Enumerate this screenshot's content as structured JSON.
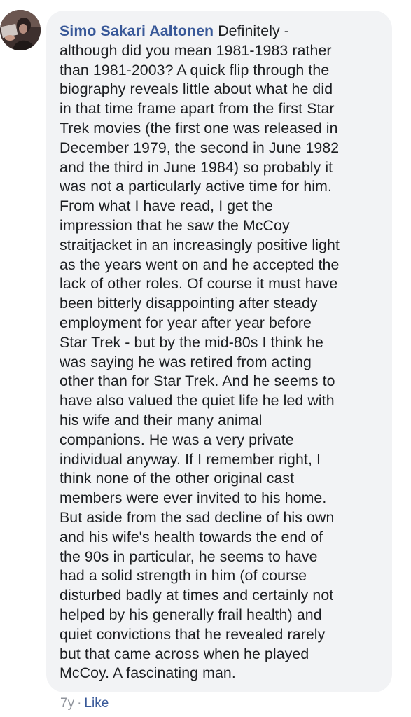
{
  "comment": {
    "author": "Simo Sakari Aaltonen",
    "lines": [
      "Definitely -",
      "although did you mean 1981-1983 rather",
      "than 1981-2003? A quick flip through the",
      "biography reveals little about what he did",
      "in that time frame apart from the first Star",
      "Trek movies (the first one was released in",
      "December 1979, the second in June 1982",
      "and the third in June 1984) so probably it",
      "was not a particularly active time for him.",
      "From what I have read, I get the",
      "impression that he saw the McCoy",
      "straitjacket in an increasingly positive light",
      "as the years went on and he accepted the",
      "lack of other roles. Of course it must have",
      "been bitterly disappointing after steady",
      "employment for year after year before",
      "Star Trek - but by the mid-80s I think he",
      "was saying he was retired from acting",
      "other than for Star Trek. And he seems to",
      "have also valued the quiet life he led with",
      "his wife and their many animal",
      "companions. He was a very private",
      "individual anyway. If I remember right, I",
      "think none of the other original cast",
      "members were ever invited to his home.",
      "But aside from the sad decline of his own",
      "and his wife's health towards the end of",
      "the 90s in particular, he seems to have",
      "had a solid strength in him (of course",
      "disturbed badly at times and certainly not",
      "helped by his generally frail health) and",
      "quiet convictions that he revealed rarely",
      "but that came across when he played",
      "McCoy. A fascinating man."
    ],
    "meta": {
      "time": "7y",
      "separator": "·",
      "like_label": "Like"
    }
  },
  "colors": {
    "author": "#385898",
    "text": "#1c1e21",
    "bubble": "#f2f3f5",
    "meta": "#90949c"
  }
}
